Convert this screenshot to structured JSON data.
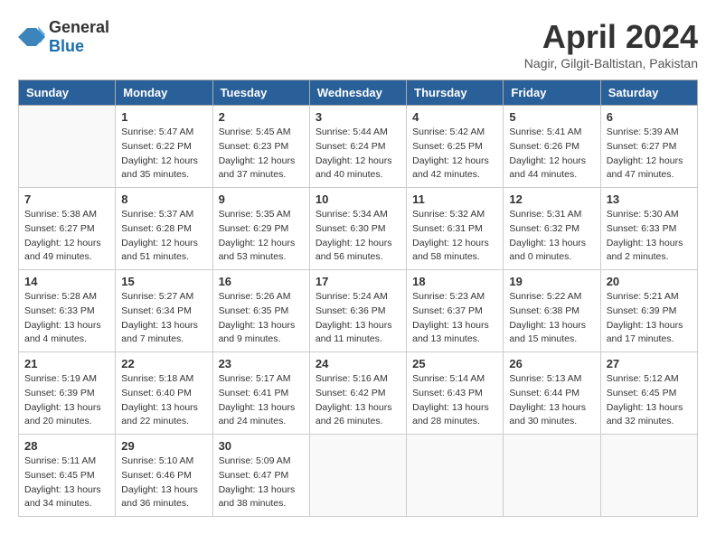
{
  "header": {
    "logo_general": "General",
    "logo_blue": "Blue",
    "month_title": "April 2024",
    "subtitle": "Nagir, Gilgit-Baltistan, Pakistan"
  },
  "weekdays": [
    "Sunday",
    "Monday",
    "Tuesday",
    "Wednesday",
    "Thursday",
    "Friday",
    "Saturday"
  ],
  "weeks": [
    [
      {
        "day": "",
        "info": ""
      },
      {
        "day": "1",
        "info": "Sunrise: 5:47 AM\nSunset: 6:22 PM\nDaylight: 12 hours\nand 35 minutes."
      },
      {
        "day": "2",
        "info": "Sunrise: 5:45 AM\nSunset: 6:23 PM\nDaylight: 12 hours\nand 37 minutes."
      },
      {
        "day": "3",
        "info": "Sunrise: 5:44 AM\nSunset: 6:24 PM\nDaylight: 12 hours\nand 40 minutes."
      },
      {
        "day": "4",
        "info": "Sunrise: 5:42 AM\nSunset: 6:25 PM\nDaylight: 12 hours\nand 42 minutes."
      },
      {
        "day": "5",
        "info": "Sunrise: 5:41 AM\nSunset: 6:26 PM\nDaylight: 12 hours\nand 44 minutes."
      },
      {
        "day": "6",
        "info": "Sunrise: 5:39 AM\nSunset: 6:27 PM\nDaylight: 12 hours\nand 47 minutes."
      }
    ],
    [
      {
        "day": "7",
        "info": "Sunrise: 5:38 AM\nSunset: 6:27 PM\nDaylight: 12 hours\nand 49 minutes."
      },
      {
        "day": "8",
        "info": "Sunrise: 5:37 AM\nSunset: 6:28 PM\nDaylight: 12 hours\nand 51 minutes."
      },
      {
        "day": "9",
        "info": "Sunrise: 5:35 AM\nSunset: 6:29 PM\nDaylight: 12 hours\nand 53 minutes."
      },
      {
        "day": "10",
        "info": "Sunrise: 5:34 AM\nSunset: 6:30 PM\nDaylight: 12 hours\nand 56 minutes."
      },
      {
        "day": "11",
        "info": "Sunrise: 5:32 AM\nSunset: 6:31 PM\nDaylight: 12 hours\nand 58 minutes."
      },
      {
        "day": "12",
        "info": "Sunrise: 5:31 AM\nSunset: 6:32 PM\nDaylight: 13 hours\nand 0 minutes."
      },
      {
        "day": "13",
        "info": "Sunrise: 5:30 AM\nSunset: 6:33 PM\nDaylight: 13 hours\nand 2 minutes."
      }
    ],
    [
      {
        "day": "14",
        "info": "Sunrise: 5:28 AM\nSunset: 6:33 PM\nDaylight: 13 hours\nand 4 minutes."
      },
      {
        "day": "15",
        "info": "Sunrise: 5:27 AM\nSunset: 6:34 PM\nDaylight: 13 hours\nand 7 minutes."
      },
      {
        "day": "16",
        "info": "Sunrise: 5:26 AM\nSunset: 6:35 PM\nDaylight: 13 hours\nand 9 minutes."
      },
      {
        "day": "17",
        "info": "Sunrise: 5:24 AM\nSunset: 6:36 PM\nDaylight: 13 hours\nand 11 minutes."
      },
      {
        "day": "18",
        "info": "Sunrise: 5:23 AM\nSunset: 6:37 PM\nDaylight: 13 hours\nand 13 minutes."
      },
      {
        "day": "19",
        "info": "Sunrise: 5:22 AM\nSunset: 6:38 PM\nDaylight: 13 hours\nand 15 minutes."
      },
      {
        "day": "20",
        "info": "Sunrise: 5:21 AM\nSunset: 6:39 PM\nDaylight: 13 hours\nand 17 minutes."
      }
    ],
    [
      {
        "day": "21",
        "info": "Sunrise: 5:19 AM\nSunset: 6:39 PM\nDaylight: 13 hours\nand 20 minutes."
      },
      {
        "day": "22",
        "info": "Sunrise: 5:18 AM\nSunset: 6:40 PM\nDaylight: 13 hours\nand 22 minutes."
      },
      {
        "day": "23",
        "info": "Sunrise: 5:17 AM\nSunset: 6:41 PM\nDaylight: 13 hours\nand 24 minutes."
      },
      {
        "day": "24",
        "info": "Sunrise: 5:16 AM\nSunset: 6:42 PM\nDaylight: 13 hours\nand 26 minutes."
      },
      {
        "day": "25",
        "info": "Sunrise: 5:14 AM\nSunset: 6:43 PM\nDaylight: 13 hours\nand 28 minutes."
      },
      {
        "day": "26",
        "info": "Sunrise: 5:13 AM\nSunset: 6:44 PM\nDaylight: 13 hours\nand 30 minutes."
      },
      {
        "day": "27",
        "info": "Sunrise: 5:12 AM\nSunset: 6:45 PM\nDaylight: 13 hours\nand 32 minutes."
      }
    ],
    [
      {
        "day": "28",
        "info": "Sunrise: 5:11 AM\nSunset: 6:45 PM\nDaylight: 13 hours\nand 34 minutes."
      },
      {
        "day": "29",
        "info": "Sunrise: 5:10 AM\nSunset: 6:46 PM\nDaylight: 13 hours\nand 36 minutes."
      },
      {
        "day": "30",
        "info": "Sunrise: 5:09 AM\nSunset: 6:47 PM\nDaylight: 13 hours\nand 38 minutes."
      },
      {
        "day": "",
        "info": ""
      },
      {
        "day": "",
        "info": ""
      },
      {
        "day": "",
        "info": ""
      },
      {
        "day": "",
        "info": ""
      }
    ]
  ]
}
